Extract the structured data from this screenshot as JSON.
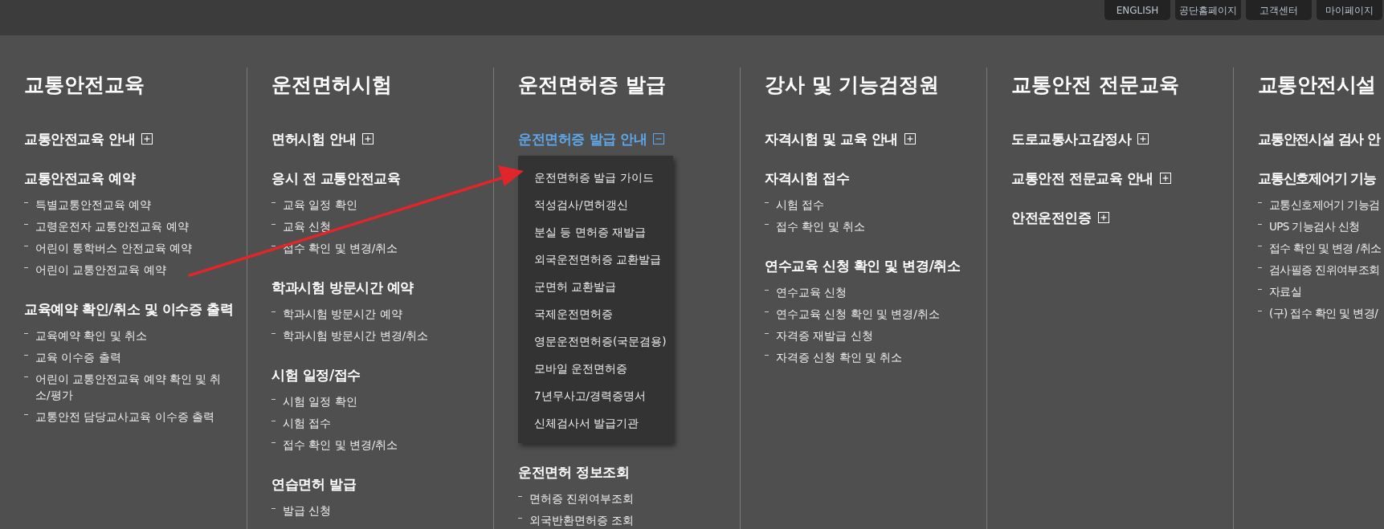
{
  "top_links": [
    "ENGLISH",
    "공단홈페이지",
    "고객센터",
    "마이페이지"
  ],
  "columns": [
    {
      "title": "교통안전교육",
      "sections": [
        {
          "title": "교통안전교육 안내",
          "expanded": false
        },
        {
          "title": "교통안전교육 예약",
          "items": [
            "특별교통안전교육 예약",
            "고령운전자 교통안전교육 예약",
            "어린이 통학버스 안전교육 예약",
            "어린이 교통안전교육 예약"
          ]
        },
        {
          "title": "교육예약 확인/취소 및 이수증 출력",
          "items": [
            "교육예약 확인 및 취소",
            "교육 이수증 출력",
            "어린이 교통안전교육 예약 확인 및 취소/평가",
            "교통안전 담당교사교육 이수증 출력"
          ]
        }
      ]
    },
    {
      "title": "운전면허시험",
      "sections": [
        {
          "title": "면허시험 안내",
          "expanded": false
        },
        {
          "title": "응시 전 교통안전교육",
          "items": [
            "교육 일정 확인",
            "교육 신청",
            "접수 확인 및 변경/취소"
          ]
        },
        {
          "title": "학과시험 방문시간 예약",
          "items": [
            "학과시험 방문시간 예약",
            "학과시험 방문시간 변경/취소"
          ]
        },
        {
          "title": "시험 일정/접수",
          "items": [
            "시험 일정 확인",
            "시험 접수",
            "접수 확인 및 변경/취소"
          ]
        },
        {
          "title": "연습면허 발급",
          "items": [
            "발급 신청"
          ]
        }
      ]
    },
    {
      "title": "운전면허증 발급",
      "sections": [
        {
          "title": "운전면허증 발급 안내",
          "expanded": true,
          "submenu": [
            "운전면허증 발급 가이드",
            "적성검사/면허갱신",
            "분실 등 면허증 재발급",
            "외국운전면허증 교환발급",
            "군면허 교환발급",
            "국제운전면허증",
            "영문운전면허증(국문겸용)",
            "모바일 운전면허증",
            "7년무사고/경력증명서",
            "신체검사서 발급기관"
          ]
        },
        {
          "title": "운전면허 정보조회",
          "items": [
            "면허증 진위여부조회",
            "외국반환면허증 조회"
          ]
        }
      ]
    },
    {
      "title": "강사 및 기능검정원",
      "sections": [
        {
          "title": "자격시험 및 교육 안내",
          "expanded": false
        },
        {
          "title": "자격시험 접수",
          "items": [
            "시험 접수",
            "접수 확인 및 취소"
          ]
        },
        {
          "title": "연수교육 신청 확인 및 변경/취소",
          "items": [
            "연수교육 신청",
            "연수교육 신청 확인 및 변경/취소",
            "자격증 재발급 신청",
            "자격증 신청 확인 및 취소"
          ]
        }
      ]
    },
    {
      "title": "교통안전 전문교육",
      "sections": [
        {
          "title": "도로교통사고감정사",
          "expanded": false
        },
        {
          "title": "교통안전 전문교육 안내",
          "expanded": false
        },
        {
          "title": "안전운전인증",
          "expanded": false
        }
      ]
    },
    {
      "title": "교통안전시설",
      "sections": [
        {
          "title": "교통안전시설 검사 안"
        },
        {
          "title": "교통신호제어기 기능",
          "items": [
            "교통신호제어기 기능검",
            "UPS 기능검사 신청",
            "접수 확인 및 변경 /취소",
            "검사필증 진위여부조회",
            "자료실",
            "(구) 접수 확인 및 변경/"
          ]
        }
      ]
    }
  ]
}
